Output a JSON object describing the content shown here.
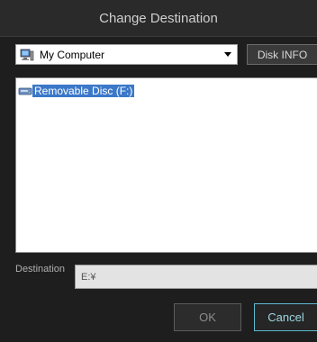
{
  "title": "Change Destination",
  "drive_select": {
    "icon": "computer-icon",
    "selected": "My Computer"
  },
  "disk_info_button": "Disk INFO",
  "tree": {
    "items": [
      {
        "icon": "removable-disc-icon",
        "label": "Removable Disc (F:)",
        "selected": true
      }
    ]
  },
  "destination": {
    "label": "Destination",
    "value": "E:¥"
  },
  "buttons": {
    "ok": "OK",
    "cancel": "Cancel"
  },
  "colors": {
    "selection": "#3b78c9",
    "cancel_border": "#5bbad0",
    "background": "#1e1e1e"
  }
}
